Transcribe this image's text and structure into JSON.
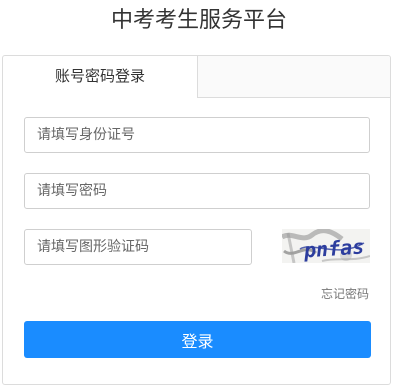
{
  "page": {
    "title": "中考考生服务平台"
  },
  "login": {
    "tab_label": "账号密码登录",
    "id_placeholder": "请填写身份证号",
    "password_placeholder": "请填写密码",
    "captcha_placeholder": "请填写图形验证码",
    "captcha_text": "pnfas",
    "forgot_label": "忘记密码",
    "submit_label": "登录"
  },
  "colors": {
    "accent": "#1a8cff",
    "border": "#dcdcdc",
    "captcha_text": "#2c3d9e"
  }
}
